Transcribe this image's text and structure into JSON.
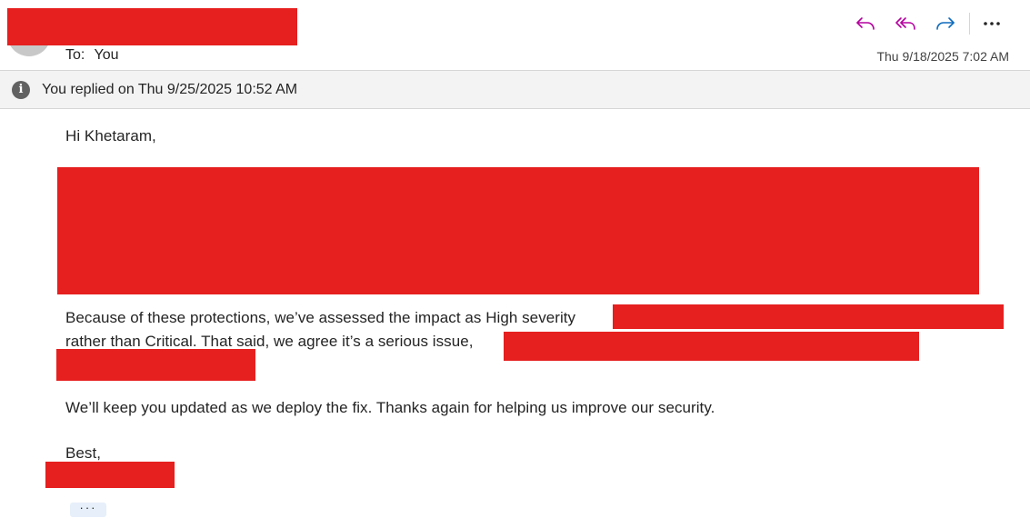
{
  "header": {
    "to_label": "To:",
    "to_value": "You",
    "date": "Thu 9/18/2025 7:02 AM",
    "actions": {
      "reply_icon": "reply-icon",
      "reply_all_icon": "reply-all-icon",
      "forward_icon": "forward-icon",
      "more_label": "···"
    },
    "accent_color": "#b4009e",
    "forward_color": "#0f6cbd"
  },
  "info_bar": {
    "icon_glyph": "i",
    "text": "You replied on Thu 9/25/2025 10:52 AM"
  },
  "body": {
    "greeting": "Hi Khetaram,",
    "para1_line1": "Because of these protections, we’ve assessed the impact as High severity",
    "para1_line2": "rather than Critical. That said, we agree it’s a serious issue,",
    "para2": "We’ll keep you updated as we deploy the fix. Thanks again for helping us improve our security.",
    "signoff": "Best,",
    "expand_label": "···"
  },
  "colors": {
    "redaction": "#e61f1f"
  }
}
